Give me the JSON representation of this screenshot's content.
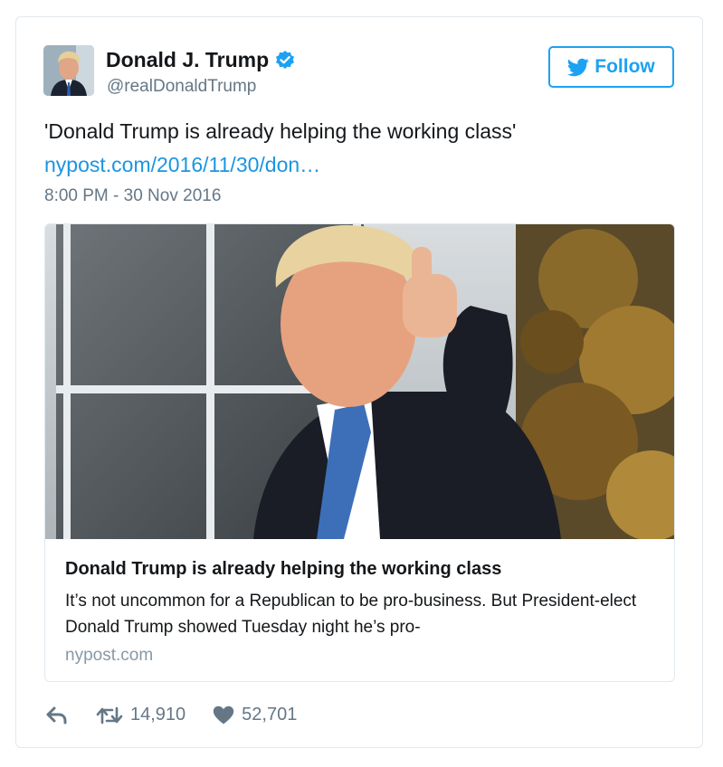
{
  "author": {
    "name": "Donald J. Trump",
    "handle": "@realDonaldTrump",
    "verified": true
  },
  "follow_button": {
    "label": "Follow",
    "icon": "twitter-bird-icon"
  },
  "tweet": {
    "text": "'Donald Trump is already helping the working class'",
    "link_text": "nypost.com/2016/11/30/don…",
    "timestamp": "8:00 PM - 30 Nov 2016"
  },
  "card": {
    "title": "Donald Trump is already helping the working class",
    "description": "It’s not uncommon for a Republican to be pro-business. But President-elect Donald Trump showed Tuesday night he’s pro-",
    "domain": "nypost.com"
  },
  "actions": {
    "reply_icon": "reply-icon",
    "retweet_icon": "retweet-icon",
    "retweet_count": "14,910",
    "like_icon": "heart-icon",
    "like_count": "52,701"
  },
  "colors": {
    "accent": "#1da1f2",
    "link": "#1b95e0",
    "secondary_text": "#657786",
    "border": "#e1e8ed"
  }
}
